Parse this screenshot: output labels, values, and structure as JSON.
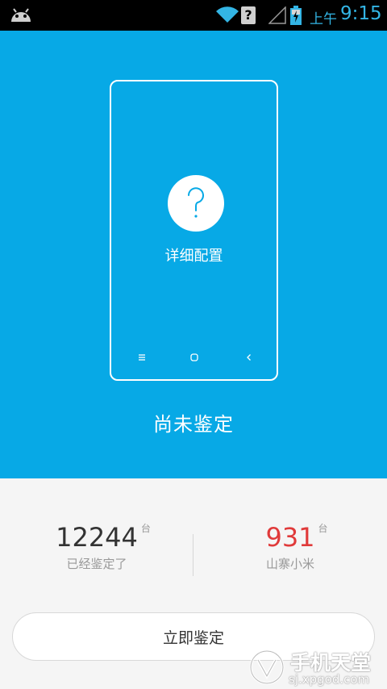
{
  "statusbar": {
    "sim_indicator": "?",
    "ampm": "上午",
    "time": "9:15"
  },
  "hero": {
    "detail_label": "详细配置",
    "status": "尚未鉴定"
  },
  "stats": {
    "appraised": {
      "count": "12244",
      "unit": "台",
      "caption": "已经鉴定了"
    },
    "counterfeit": {
      "count": "931",
      "unit": "台",
      "caption": "山寨小米"
    }
  },
  "action": {
    "label": "立即鉴定"
  },
  "watermark": {
    "brand": "手机天堂",
    "url": "sj.xpgod.com"
  },
  "colors": {
    "hero_bg": "#07a9e6",
    "accent_red": "#e03a3a",
    "status_blue": "#33b5e5"
  },
  "icons": [
    "android-icon",
    "wifi-icon",
    "signal-icon",
    "battery-icon",
    "question-icon",
    "menu-icon",
    "home-icon",
    "back-icon"
  ]
}
